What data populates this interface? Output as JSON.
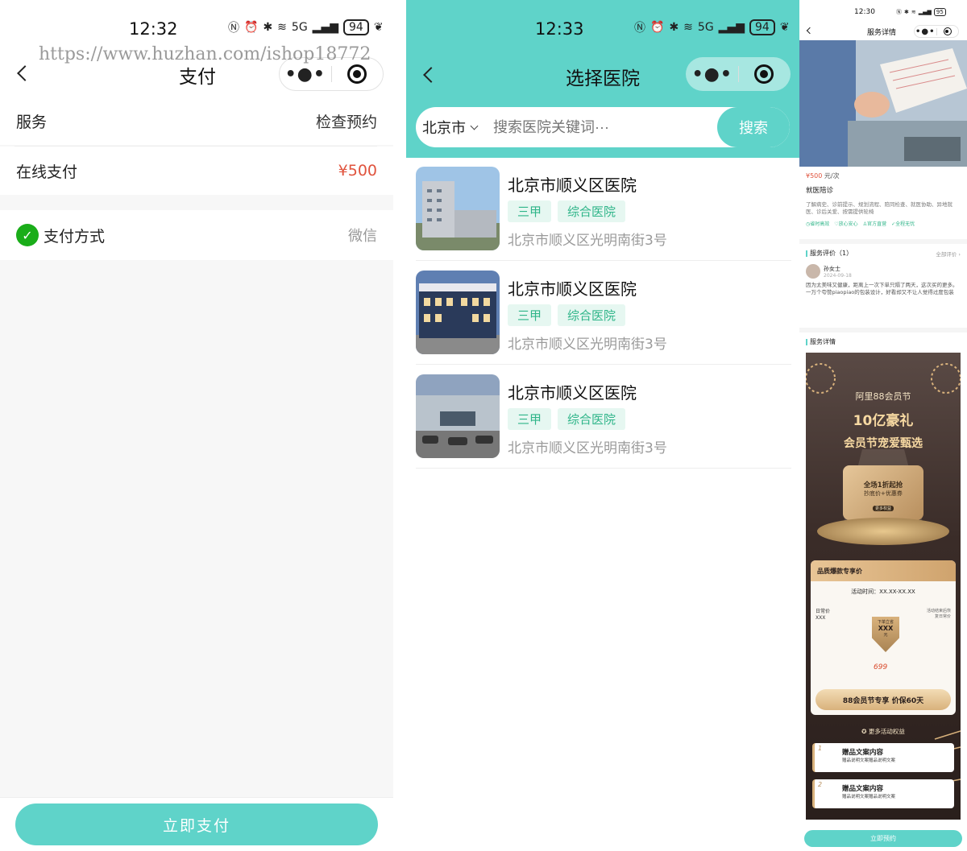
{
  "watermark": "https://www.huzhan.com/ishop18772",
  "colors": {
    "accent": "#5fd3c9",
    "price": "#e0533d",
    "tag_bg": "#e6f7f1",
    "tag_text": "#2fb589",
    "wechat": "#1aad19"
  },
  "panel1": {
    "status": {
      "time": "12:32",
      "signal": "5G",
      "battery": "94"
    },
    "nav": {
      "title": "支付",
      "more_icon": "•●•",
      "target_icon": "target-icon"
    },
    "rows": [
      {
        "label": "服务",
        "value": "检查预约"
      },
      {
        "label": "在线支付",
        "value": "¥500"
      }
    ],
    "payment": {
      "label": "支付方式",
      "value": "微信",
      "icon": "wechat-pay-icon"
    },
    "pay_button": "立即支付"
  },
  "panel2": {
    "status": {
      "time": "12:33",
      "signal": "5G",
      "battery": "94"
    },
    "nav": {
      "title": "选择医院",
      "more_icon": "•●•"
    },
    "search": {
      "city": "北京市",
      "placeholder": "搜索医院关键词···",
      "button": "搜索"
    },
    "hospitals": [
      {
        "name": "北京市顺义区医院",
        "tags": [
          "三甲",
          "综合医院"
        ],
        "address": "北京市顺义区光明南街3号"
      },
      {
        "name": "北京市顺义区医院",
        "tags": [
          "三甲",
          "综合医院"
        ],
        "address": "北京市顺义区光明南街3号"
      },
      {
        "name": "北京市顺义区医院",
        "tags": [
          "三甲",
          "综合医院"
        ],
        "address": "北京市顺义区光明南街3号"
      }
    ]
  },
  "panel3": {
    "status": {
      "time": "12:30",
      "battery": "95"
    },
    "nav": {
      "title": "服务详情",
      "more_icon": "•●•"
    },
    "price": "¥500",
    "price_unit": "元/次",
    "service_name": "就医陪诊",
    "service_desc": "了解病史、诊前提示、规划流程、陪同检查、就医协助、异地就医、诊后关爱、按需提供轮椅",
    "badges": [
      "省时高效",
      "放心安心",
      "官方直营",
      "全程无忧"
    ],
    "review": {
      "section_title": "服务评价（1）",
      "more": "全部评价 ›",
      "user": "孙女士",
      "date": "2024-09-18",
      "text": "因为太美味又健康，距离上一次下单只隔了两天，这次买的更多。一万个夸赞piaopiao的包装设计，好看却又不让人觉得过度包装"
    },
    "detail": {
      "section_title": "服务详情",
      "brand": "阿里88会员节",
      "headline_1": "10亿豪礼",
      "headline_2": "会员节宠爱甄选",
      "card_a": "全场1折起抢",
      "card_b": "抄底价+优惠券",
      "card_c": "更多权益",
      "box_title": "品质爆款专享价",
      "box_time": "活动时间：XX.XX-XX.XX",
      "box_left_label": "日常价",
      "box_left_value": "XXX",
      "box_right_label": "活动结束后恢复日常价",
      "box_mid_label": "下单立省",
      "box_mid_value": "XXX",
      "box_mid_unit": "元",
      "box_price": "699",
      "box_button": "88会员节专享  价保60天",
      "more_rights": "更多活动权益",
      "gifts": [
        {
          "no": "1",
          "title": "赠品文案内容",
          "desc": "赠品说明文案赠品说明文案"
        },
        {
          "no": "2",
          "title": "赠品文案内容",
          "desc": "赠品说明文案赠品说明文案"
        }
      ]
    },
    "book_button": "立即预约"
  }
}
